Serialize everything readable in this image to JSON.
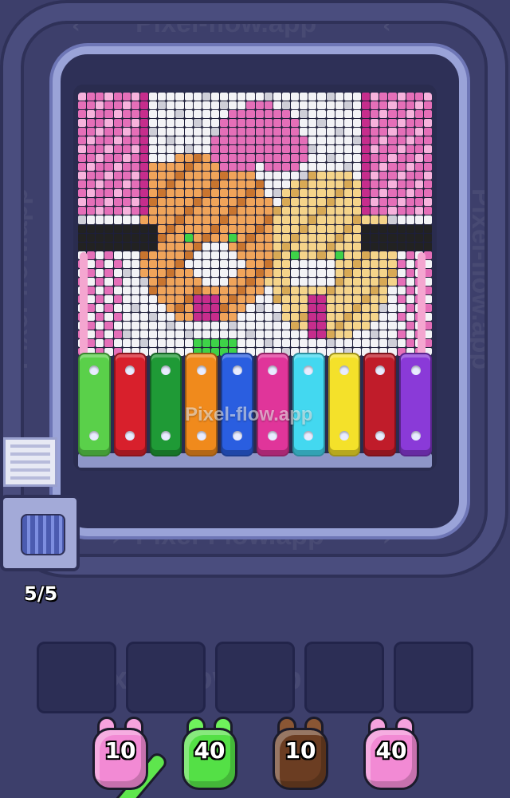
{
  "watermark": {
    "top": "Pixel-flow.app",
    "center": "Pixel-flow.app",
    "bottom_track": "Pixel-Flow.app",
    "slots": "Pixel-Flow.app",
    "left_side": "Pixel-flow.app",
    "right_side": "Pixel-flow.app"
  },
  "progress": {
    "counter": "5/5",
    "current": 5,
    "total": 5
  },
  "bars": [
    {
      "color": "#5ad04a"
    },
    {
      "color": "#d8202c"
    },
    {
      "color": "#1f9a36"
    },
    {
      "color": "#f08a1c"
    },
    {
      "color": "#2a5ee0"
    },
    {
      "color": "#e0359a"
    },
    {
      "color": "#43d8f0"
    },
    {
      "color": "#f4e12a"
    },
    {
      "color": "#c01c2a"
    },
    {
      "color": "#8a3ad8"
    }
  ],
  "shooters": [
    {
      "value": "10",
      "color": "#f28ad4",
      "ear": "#f6a3de"
    },
    {
      "value": "40",
      "color": "#54e046",
      "ear": "#6ff35c"
    },
    {
      "value": "10",
      "color": "#6b3d22",
      "ear": "#8a5634"
    },
    {
      "value": "40",
      "color": "#f28ad4",
      "ear": "#f6a3de"
    }
  ],
  "slots_count": 5,
  "pixel_palette": {
    "pink": "#e56fb8",
    "deep_pink": "#c62d8c",
    "light_pink": "#f7b2dc",
    "white": "#f3f3f6",
    "gray": "#cfcfd8",
    "black": "#222",
    "orange": "#f0a45a",
    "dark_orange": "#c9752f",
    "tan": "#f5d48a",
    "dark_tan": "#d8a955",
    "green": "#3ed248"
  }
}
